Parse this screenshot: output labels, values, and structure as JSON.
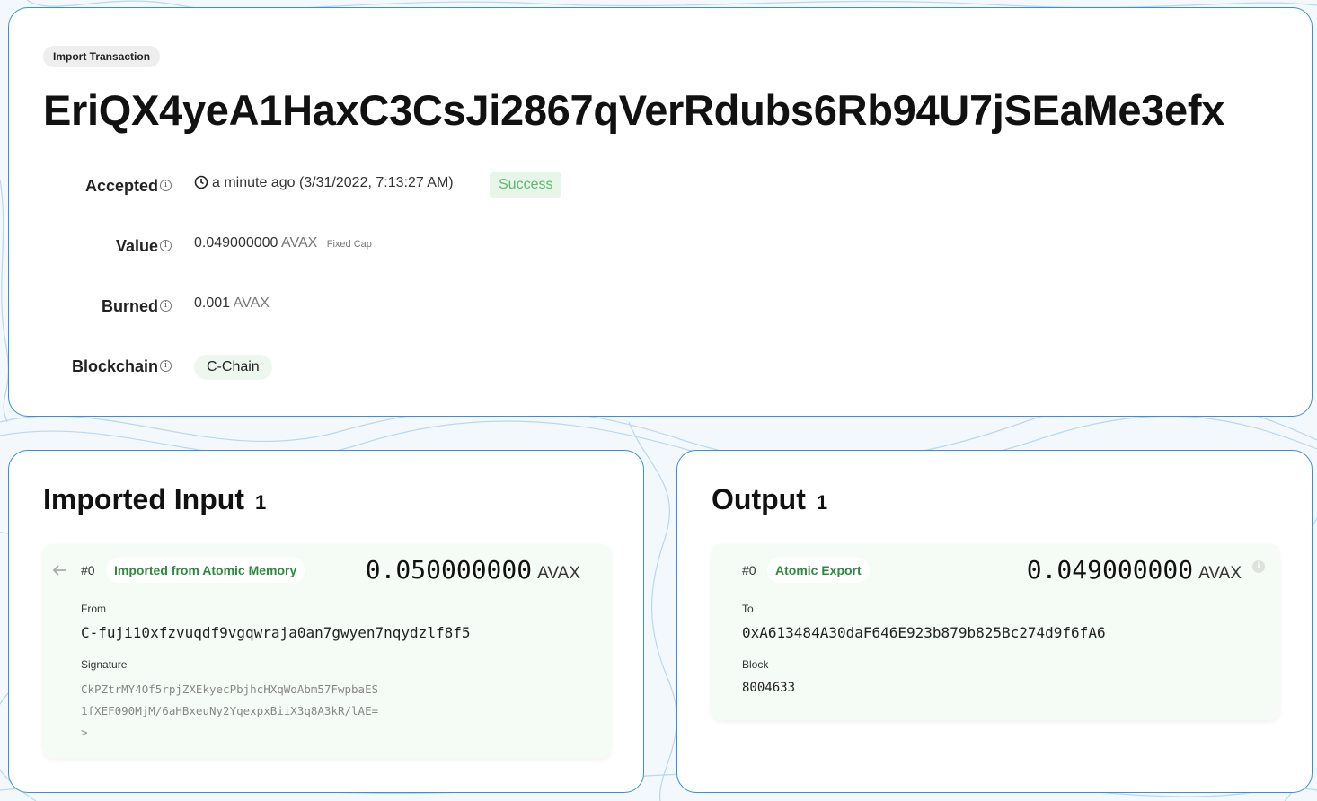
{
  "transaction": {
    "type_badge": "Import Transaction",
    "id": "EriQX4yeA1HaxC3CsJi2867qVerRdubs6Rb94U7jSEaMe3efx"
  },
  "details": {
    "accepted": {
      "label": "Accepted",
      "time": "a minute ago (3/31/2022, 7:13:27 AM)",
      "status": "Success"
    },
    "value": {
      "label": "Value",
      "amount": "0.049000000",
      "unit": "AVAX",
      "tag": "Fixed Cap"
    },
    "burned": {
      "label": "Burned",
      "amount": "0.001",
      "unit": "AVAX"
    },
    "blockchain": {
      "label": "Blockchain",
      "chain": "C-Chain"
    },
    "info_icon_glyph": "i"
  },
  "imported_input": {
    "title": "Imported Input",
    "count": "1",
    "utxo": {
      "index": "#0",
      "type": "Imported from Atomic Memory",
      "amount": "0.050000000",
      "unit": "AVAX",
      "from_label": "From",
      "from_value": "C-fuji10xfzvuqdf9vgqwraja0an7gwyen7nqydzlf8f5",
      "signature_label": "Signature",
      "signature_line1": "CkPZtrMY4Of5rpjZXEkyecPbjhcHXqWoAbm57FwpbaES",
      "signature_line2": "1fXEF090MjM/6aHBxeuNy2YqexpxBiiX3q8A3kR/lAE=",
      "signature_expand": ">"
    }
  },
  "output": {
    "title": "Output",
    "count": "1",
    "utxo": {
      "index": "#0",
      "type": "Atomic Export",
      "amount": "0.049000000",
      "unit": "AVAX",
      "to_label": "To",
      "to_value": "0xA613484A30daF646E923b879b825Bc274d9f6fA6",
      "block_label": "Block",
      "block_value": "8004633"
    }
  },
  "colors": {
    "card_border": "#3b8fd6",
    "success_bg": "#e8f6ea",
    "success_text": "#5cba6a",
    "utxo_bg": "#f5fcf5",
    "utxo_type_text": "#2b8a3e"
  },
  "icons": {
    "info": "info-icon",
    "clock": "clock-icon",
    "arrow_left": "arrow-left-icon",
    "info_dot": "info-dot-icon"
  }
}
